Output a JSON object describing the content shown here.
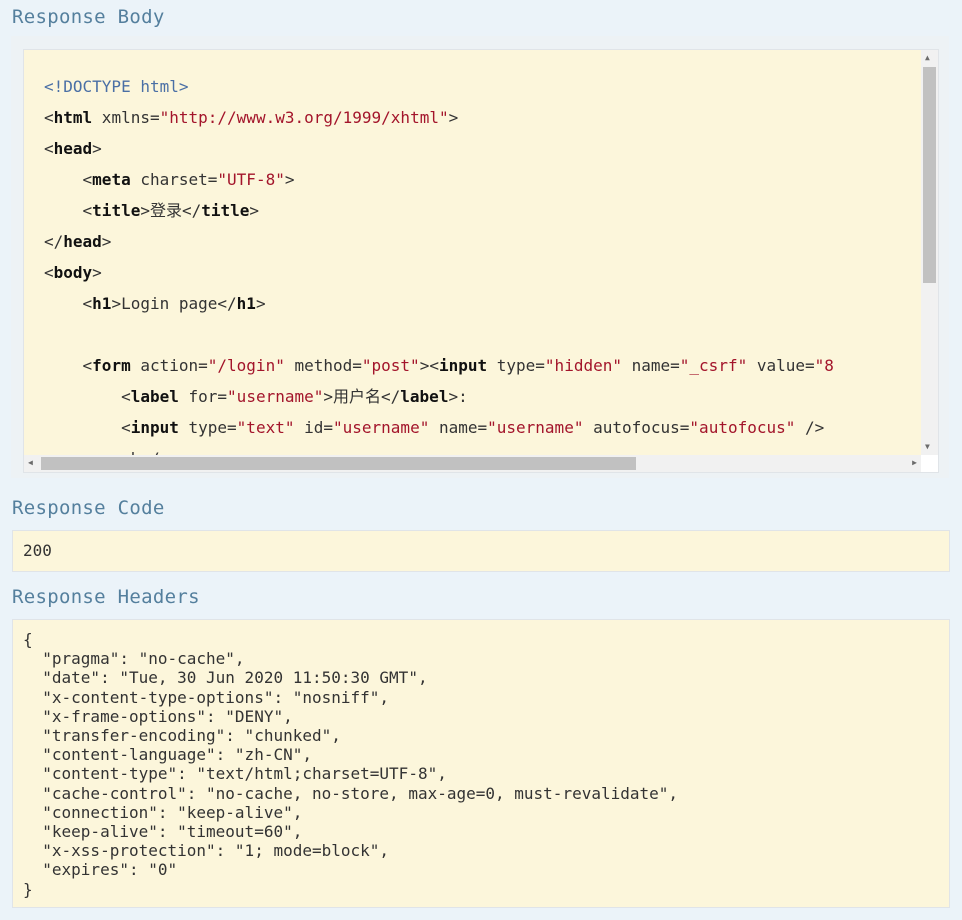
{
  "sections": {
    "response_body": "Response Body",
    "response_code": "Response Code",
    "response_headers": "Response Headers"
  },
  "code_lines": [
    [
      {
        "c": "doctype",
        "t": "<!DOCTYPE html>"
      }
    ],
    [
      {
        "c": "txt",
        "t": "<"
      },
      {
        "c": "tag",
        "t": "html"
      },
      {
        "c": "attr",
        "t": " xmlns="
      },
      {
        "c": "val",
        "t": "\"http://www.w3.org/1999/xhtml\""
      },
      {
        "c": "txt",
        "t": ">"
      }
    ],
    [
      {
        "c": "txt",
        "t": "<"
      },
      {
        "c": "tag",
        "t": "head"
      },
      {
        "c": "txt",
        "t": ">"
      }
    ],
    [
      {
        "c": "txt",
        "t": "    <"
      },
      {
        "c": "tag",
        "t": "meta"
      },
      {
        "c": "attr",
        "t": " charset="
      },
      {
        "c": "val",
        "t": "\"UTF-8\""
      },
      {
        "c": "txt",
        "t": ">"
      }
    ],
    [
      {
        "c": "txt",
        "t": "    <"
      },
      {
        "c": "tag",
        "t": "title"
      },
      {
        "c": "txt",
        "t": ">登录</"
      },
      {
        "c": "tag",
        "t": "title"
      },
      {
        "c": "txt",
        "t": ">"
      }
    ],
    [
      {
        "c": "txt",
        "t": "</"
      },
      {
        "c": "tag",
        "t": "head"
      },
      {
        "c": "txt",
        "t": ">"
      }
    ],
    [
      {
        "c": "txt",
        "t": "<"
      },
      {
        "c": "tag",
        "t": "body"
      },
      {
        "c": "txt",
        "t": ">"
      }
    ],
    [
      {
        "c": "txt",
        "t": "    <"
      },
      {
        "c": "tag",
        "t": "h1"
      },
      {
        "c": "txt",
        "t": ">Login page</"
      },
      {
        "c": "tag",
        "t": "h1"
      },
      {
        "c": "txt",
        "t": ">"
      }
    ],
    [
      {
        "c": "txt",
        "t": " "
      }
    ],
    [
      {
        "c": "txt",
        "t": "    <"
      },
      {
        "c": "tag",
        "t": "form"
      },
      {
        "c": "attr",
        "t": " action="
      },
      {
        "c": "val",
        "t": "\"/login\""
      },
      {
        "c": "attr",
        "t": " method="
      },
      {
        "c": "val",
        "t": "\"post\""
      },
      {
        "c": "txt",
        "t": "><"
      },
      {
        "c": "tag",
        "t": "input"
      },
      {
        "c": "attr",
        "t": " type="
      },
      {
        "c": "val",
        "t": "\"hidden\""
      },
      {
        "c": "attr",
        "t": " name="
      },
      {
        "c": "val",
        "t": "\"_csrf\""
      },
      {
        "c": "attr",
        "t": " value="
      },
      {
        "c": "val",
        "t": "\"8"
      }
    ],
    [
      {
        "c": "txt",
        "t": "        <"
      },
      {
        "c": "tag",
        "t": "label"
      },
      {
        "c": "attr",
        "t": " for="
      },
      {
        "c": "val",
        "t": "\"username\""
      },
      {
        "c": "txt",
        "t": ">用户名</"
      },
      {
        "c": "tag",
        "t": "label"
      },
      {
        "c": "txt",
        "t": ">:"
      }
    ],
    [
      {
        "c": "txt",
        "t": "        <"
      },
      {
        "c": "tag",
        "t": "input"
      },
      {
        "c": "attr",
        "t": " type="
      },
      {
        "c": "val",
        "t": "\"text\""
      },
      {
        "c": "attr",
        "t": " id="
      },
      {
        "c": "val",
        "t": "\"username\""
      },
      {
        "c": "attr",
        "t": " name="
      },
      {
        "c": "val",
        "t": "\"username\""
      },
      {
        "c": "attr",
        "t": " autofocus="
      },
      {
        "c": "val",
        "t": "\"autofocus\""
      },
      {
        "c": "txt",
        "t": " />"
      }
    ],
    [
      {
        "c": "txt",
        "t": "        <br/>"
      }
    ]
  ],
  "response_code": "200",
  "response_headers_text": "{\n  \"pragma\": \"no-cache\",\n  \"date\": \"Tue, 30 Jun 2020 11:50:30 GMT\",\n  \"x-content-type-options\": \"nosniff\",\n  \"x-frame-options\": \"DENY\",\n  \"transfer-encoding\": \"chunked\",\n  \"content-language\": \"zh-CN\",\n  \"content-type\": \"text/html;charset=UTF-8\",\n  \"cache-control\": \"no-cache, no-store, max-age=0, must-revalidate\",\n  \"connection\": \"keep-alive\",\n  \"keep-alive\": \"timeout=60\",\n  \"x-xss-protection\": \"1; mode=block\",\n  \"expires\": \"0\"\n}",
  "icons": {
    "scroll_up": "▲",
    "scroll_down": "▼",
    "scroll_left": "◀",
    "scroll_right": "▶"
  }
}
